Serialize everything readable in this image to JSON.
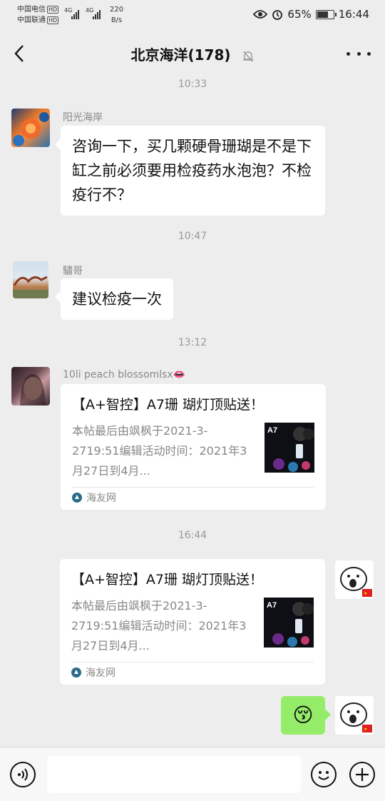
{
  "status": {
    "carrier1": "中国电信",
    "carrier2": "中国联通",
    "hd": "HD",
    "net1": "4G",
    "net2": "4G",
    "speed_value": "220",
    "speed_unit": "B/s",
    "battery": "65%",
    "time": "16:44"
  },
  "header": {
    "title": "北京海洋(178)"
  },
  "messages": [
    {
      "time": "10:33",
      "sender": "阳光海岸",
      "text": "咨询一下，买几颗硬骨珊瑚是不是下缸之前必须要用检疫药水泡泡？不检疫行不？"
    },
    {
      "time": "10:47",
      "sender": "驌哥",
      "text": "建议检疫一次"
    },
    {
      "time": "13:12",
      "sender": "10li peach blossomlsx👄",
      "card": {
        "title": "【A+智控】A7珊 瑚灯顶贴送！",
        "desc": "本帖最后由飒枫于2021-3-2719:51编辑活动时间：2021年3月27日到4月...",
        "source": "海友网",
        "thumb_label": "A7"
      }
    },
    {
      "time": "16:44",
      "card": {
        "title": "【A+智控】A7珊 瑚灯顶贴送！",
        "desc": "本帖最后由飒枫于2021-3-2719:51编辑活动时间：2021年3月27日到4月...",
        "source": "海友网",
        "thumb_label": "A7"
      }
    },
    {
      "emoji": "😚"
    }
  ],
  "icons": {
    "back": "chevron-left-icon",
    "mute": "bell-off-icon",
    "more": "more-dots-icon",
    "voice": "voice-icon",
    "emoji": "emoji-icon",
    "plus": "plus-icon"
  },
  "colors": {
    "background": "#ededed",
    "bubble_self": "#95ec69",
    "bubble_other": "#ffffff"
  }
}
